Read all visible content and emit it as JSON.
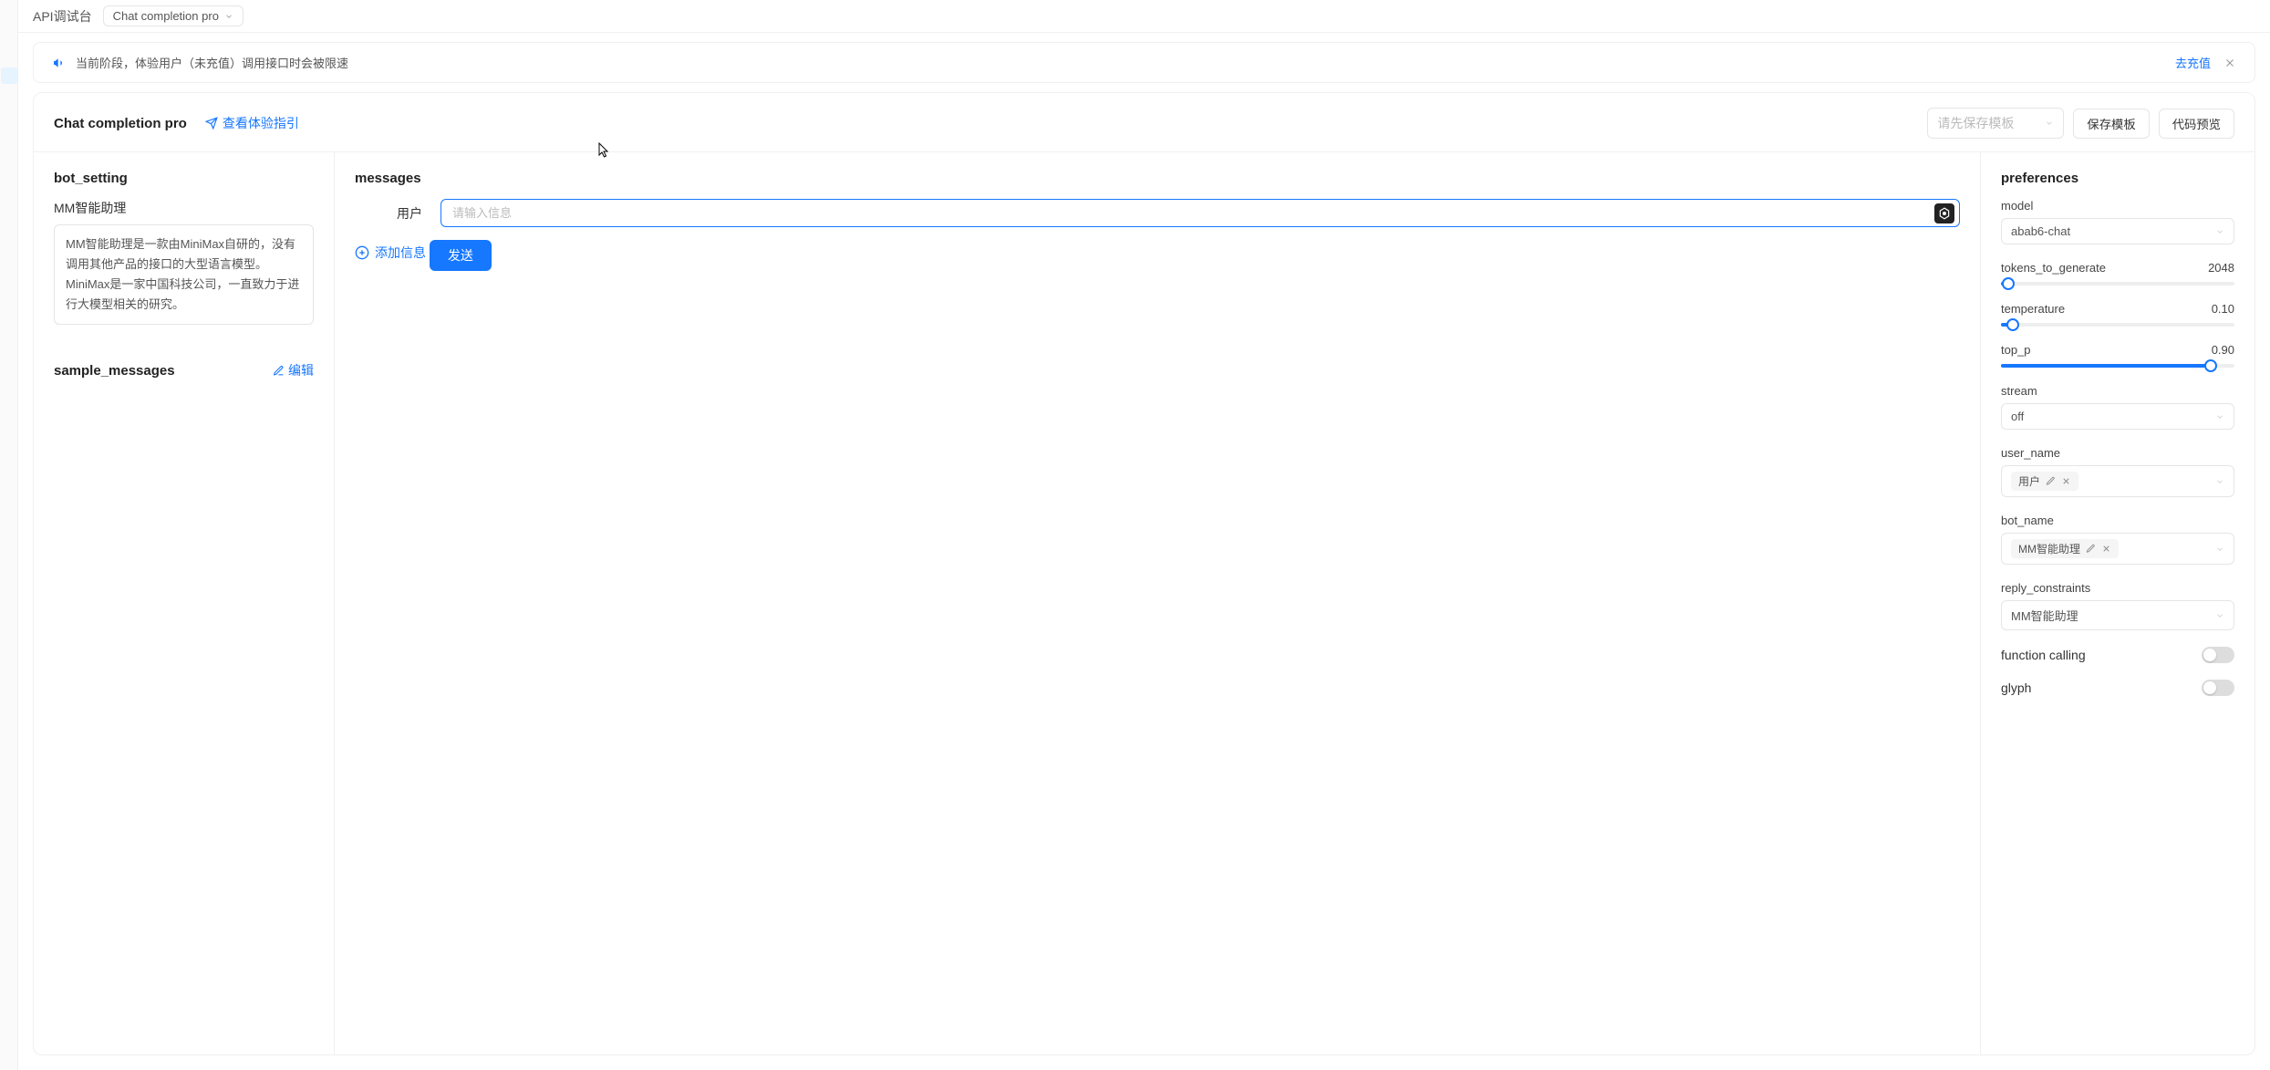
{
  "topbar": {
    "title": "API调试台",
    "selector": "Chat completion pro"
  },
  "alert": {
    "text": "当前阶段，体验用户（未充值）调用接口时会被限速",
    "link": "去充值"
  },
  "head": {
    "title": "Chat completion pro",
    "guide": "查看体验指引",
    "templatePlaceholder": "请先保存模板",
    "saveTemplate": "保存模板",
    "codePreview": "代码预览"
  },
  "left": {
    "botSettingTitle": "bot_setting",
    "botName": "MM智能助理",
    "botDesc": "MM智能助理是一款由MiniMax自研的，没有调用其他产品的接口的大型语言模型。MiniMax是一家中国科技公司，一直致力于进行大模型相关的研究。",
    "sampleTitle": "sample_messages",
    "editLabel": "编辑"
  },
  "mid": {
    "title": "messages",
    "role": "用户",
    "inputPlaceholder": "请输入信息",
    "addInfo": "添加信息",
    "send": "发送"
  },
  "prefs": {
    "title": "preferences",
    "modelLabel": "model",
    "modelValue": "abab6-chat",
    "tokensLabel": "tokens_to_generate",
    "tokensValue": "2048",
    "tokensPercent": 3,
    "tempLabel": "temperature",
    "tempValue": "0.10",
    "tempPercent": 5,
    "toppLabel": "top_p",
    "toppValue": "0.90",
    "toppPercent": 90,
    "streamLabel": "stream",
    "streamValue": "off",
    "userNameLabel": "user_name",
    "userNameTag": "用户",
    "botNameLabel": "bot_name",
    "botNameTag": "MM智能助理",
    "replyLabel": "reply_constraints",
    "replyValue": "MM智能助理",
    "funcCallLabel": "function calling",
    "glyphLabel": "glyph"
  }
}
